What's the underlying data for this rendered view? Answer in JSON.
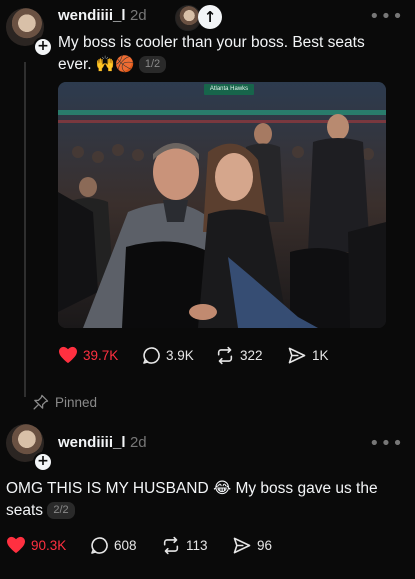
{
  "post1": {
    "username": "wendiiii_l",
    "time": "2d",
    "text": "My boss is cooler than your boss. Best seats ever.",
    "emoji": "🙌🏀",
    "page_badge": "1/2",
    "photo_overlay_text": "Atlanta Hawks",
    "actions": {
      "likes": "39.7K",
      "replies": "3.9K",
      "reposts": "322",
      "shares": "1K"
    }
  },
  "pinned_label": "Pinned",
  "post2": {
    "username": "wendiiii_l",
    "time": "2d",
    "text_part1": "OMG THIS IS MY HUSBAND",
    "emoji": "😂",
    "text_part2": "My boss gave us the seats",
    "page_badge": "2/2",
    "actions": {
      "likes": "90.3K",
      "replies": "608",
      "reposts": "113",
      "shares": "96"
    }
  },
  "colors": {
    "background": "#0a0a0a",
    "like": "#ff3040",
    "muted": "#777777"
  },
  "icons": [
    "heart-icon",
    "reply-icon",
    "repost-icon",
    "share-icon",
    "pin-icon",
    "more-icon",
    "plus-icon",
    "arrow-up-icon"
  ]
}
